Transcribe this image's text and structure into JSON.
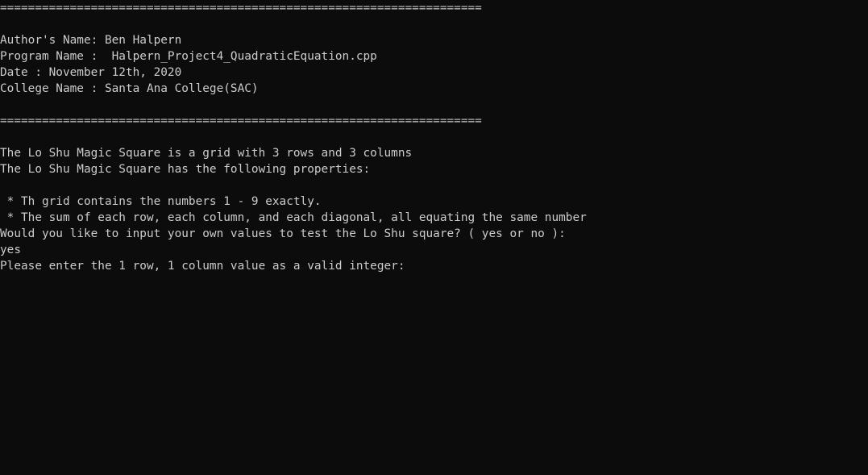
{
  "console": {
    "lines": [
      "=====================================================================",
      "",
      "Author's Name: Ben Halpern",
      "Program Name :  Halpern_Project4_QuadraticEquation.cpp",
      "Date : November 12th, 2020",
      "College Name : Santa Ana College(SAC)",
      "",
      "=====================================================================",
      "",
      "The Lo Shu Magic Square is a grid with 3 rows and 3 columns",
      "The Lo Shu Magic Square has the following properties:",
      "",
      " * Th grid contains the numbers 1 - 9 exactly.",
      " * The sum of each row, each column, and each diagonal, all equating the same number",
      "Would you like to input your own values to test the Lo Shu square? ( yes or no ):",
      "yes",
      "Please enter the 1 row, 1 column value as a valid integer:"
    ]
  },
  "colors": {
    "background": "#0c0c0c",
    "text": "#cccccc"
  }
}
